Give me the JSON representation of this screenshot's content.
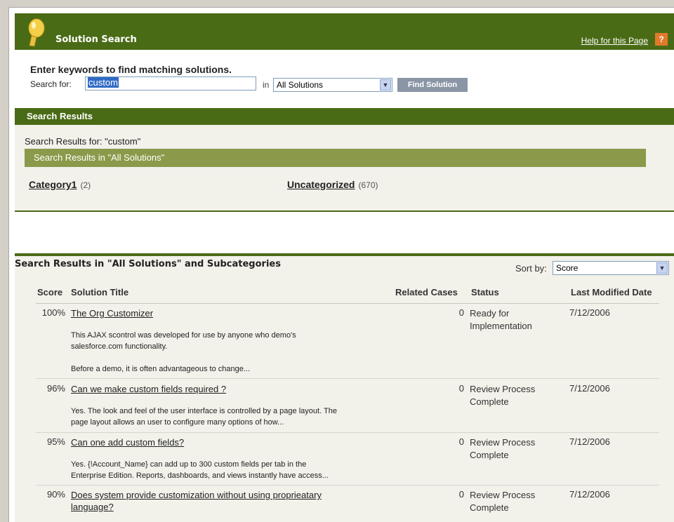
{
  "header": {
    "title": "Solution Search",
    "help_link": "Help for this Page",
    "help_icon": "?"
  },
  "search": {
    "prompt": "Enter keywords to find matching solutions.",
    "label": "Search for:",
    "value": "custom",
    "in_label": "in",
    "scope": "All Solutions",
    "button": "Find Solution"
  },
  "results": {
    "bar_title": "Search Results",
    "results_for": "Search Results for: \"custom\"",
    "scope_bar": "Search Results in \"All Solutions\"",
    "categories": [
      {
        "name": "Category1",
        "count": "(2)"
      },
      {
        "name": "Uncategorized",
        "count": "(670)"
      }
    ]
  },
  "list": {
    "title": "Search Results in \"All Solutions\" and Subcategories",
    "sort_label": "Sort by:",
    "sort_value": "Score",
    "columns": [
      "Score",
      "Solution Title",
      "Related Cases",
      "Status",
      "Last Modified Date"
    ],
    "rows": [
      {
        "score": "100%",
        "title": "The Org Customizer",
        "snippet1": "This AJAX scontrol was developed for use by anyone who demo's",
        "snippet2": "salesforce.com functionality.",
        "snippet3": "Before a demo, it is often advantageous to change...",
        "related": "0",
        "status1": "Ready for",
        "status2": "Implementation",
        "date": "7/12/2006"
      },
      {
        "score": "96%",
        "title": "Can we make custom fields required ?",
        "snippet1": "Yes. The look and feel of the user interface is controlled by a page layout. The",
        "snippet2": "page layout allows an user to configure many options of how...",
        "related": "0",
        "status1": "Review Process",
        "status2": "Complete",
        "date": "7/12/2006"
      },
      {
        "score": "95%",
        "title": "Can one add custom fields?",
        "snippet1": "Yes. {!Account_Name} can add up to 300 custom fields per tab in the",
        "snippet2": "Enterprise Edition. Reports, dashboards, and views instantly have access...",
        "related": "0",
        "status1": "Review Process",
        "status2": "Complete",
        "date": "7/12/2006"
      },
      {
        "score": "90%",
        "title1": "Does system provide customization without using proprieatary",
        "title2": "language?",
        "related": "0",
        "status1": "Review Process",
        "status2": "Complete",
        "date": "7/12/2006"
      }
    ]
  },
  "colors": {
    "header_green": "#4a6b16",
    "olive_bar": "#8a9a4a",
    "panel_beige": "#f2f1ea",
    "help_orange": "#e07a2a",
    "selection_blue": "#316ac5"
  }
}
